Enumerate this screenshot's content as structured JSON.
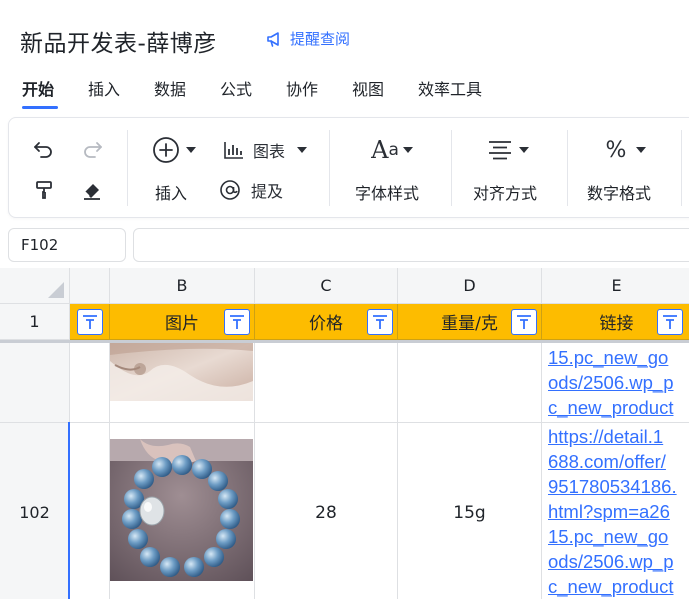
{
  "header": {
    "title": "新品开发表-薛博彦",
    "reminder_label": "提醒查阅"
  },
  "menu": {
    "tabs": [
      "开始",
      "插入",
      "数据",
      "公式",
      "协作",
      "视图",
      "效率工具"
    ],
    "active": "开始"
  },
  "toolbar": {
    "insert_label": "插入",
    "chart_label": "图表",
    "mention_label": "提及",
    "font_style_label": "字体样式",
    "align_label": "对齐方式",
    "number_format_label": "数字格式"
  },
  "formula_bar": {
    "cell_ref": "F102",
    "formula": ""
  },
  "grid": {
    "columns": [
      "B",
      "C",
      "D",
      "E"
    ],
    "header_row_number": "1",
    "header_cells": [
      "",
      "图片",
      "价格",
      "重量/克",
      "链接"
    ],
    "rows": [
      {
        "row_number": "",
        "price": "",
        "weight": "",
        "link_lines": [
          "15.pc_new_go",
          "ods/2506.wp_p",
          "c_new_product"
        ]
      },
      {
        "row_number": "102",
        "price": "28",
        "weight": "15g",
        "link_lines": [
          "https://detail.1",
          "688.com/offer/",
          "951780534186.",
          "html?spm=a26",
          "15.pc_new_go",
          "ods/2506.wp_p",
          "c_new_product"
        ]
      }
    ]
  },
  "colors": {
    "accent": "#3370ff",
    "header_fill": "#fdbc00"
  }
}
